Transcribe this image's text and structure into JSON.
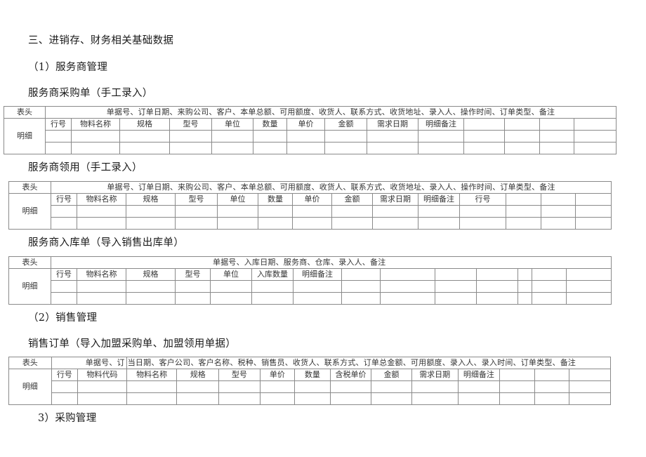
{
  "headings": {
    "section3": "三、进销存、财务相关基础数据",
    "sub1": "（1）服务商管理",
    "table1_title": "服务商采购单（手工录入）",
    "table2_title": "服务商领用（手工录入）",
    "table3_title": "服务商入库单（导入销售出库单）",
    "sub2": "（2）销售管理",
    "table4_title": "销售订单（导入加盟采购单、加盟领用单据）",
    "sub3": "3）采购管理"
  },
  "tables": [
    {
      "header_label": "表头",
      "detail_label": "明细",
      "header_fields": "单据号、订单日期、来购公司、客户、本单总额、可用额度、收货人、联系方式、收货地址、录入人、操作时间、订单类型、备注",
      "columns": [
        "行号",
        "物料名称",
        "规格",
        "型号",
        "单位",
        "数量",
        "单价",
        "金额",
        "需求日期",
        "明细备注",
        "",
        "",
        "",
        ""
      ]
    },
    {
      "header_label": "表头",
      "detail_label": "明细",
      "header_fields": "单据号、订单日期、来购公司、客户、本单总额、可用额度、收货人、联系方式、收货地址、录入人、操作时间、订单类型、备注",
      "columns": [
        "行号",
        "物料名称",
        "规格",
        "型号",
        "单位",
        "数量",
        "单价",
        "金额",
        "需求日期",
        "明细备注",
        "行号",
        "",
        "",
        ""
      ]
    },
    {
      "header_label": "表头",
      "detail_label": "明细",
      "header_fields": "单据号、入库日期、服务商、仓库、录入人、备注",
      "columns": [
        "行号",
        "物料名称",
        "规格",
        "型号",
        "单位",
        "入库数量",
        "明细备注",
        "",
        "",
        "",
        "",
        "",
        "",
        ""
      ]
    },
    {
      "header_label": "表头",
      "detail_label": "明细",
      "header_fields_part1": "单据号、订",
      "header_fields_part2": "当日期、客户公司、客户名称、税种、销售员、收货人、联系方式、订单总金额、可用额度、录入人、录入时间、订单类型、备注",
      "columns": [
        "行号",
        "物料代码",
        "物料名称",
        "规格",
        "型号",
        "单价",
        "数量",
        "含税单价",
        "金额",
        "需求日期",
        "明细备注",
        "",
        "",
        ""
      ]
    }
  ]
}
